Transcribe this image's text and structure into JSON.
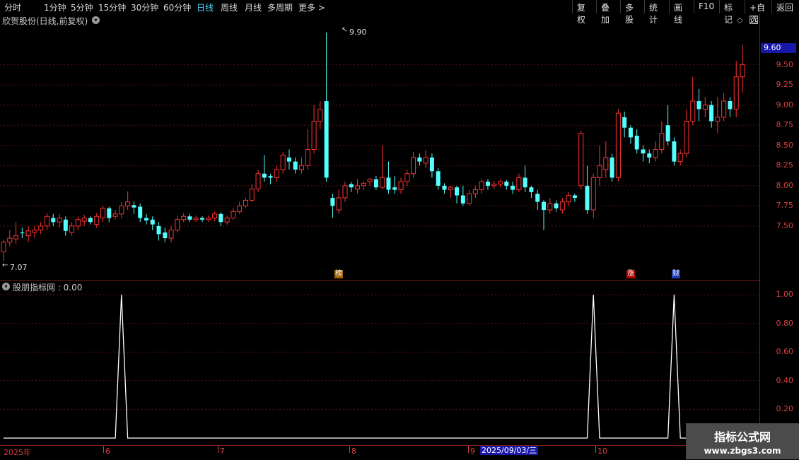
{
  "toolbar": {
    "periods": [
      "分时",
      "1分钟",
      "5分钟",
      "15分钟",
      "30分钟",
      "60分钟",
      "日线",
      "周线",
      "月线",
      "多周期",
      "更多 >"
    ],
    "active_period": "日线",
    "actions": [
      "复权",
      "叠加",
      "多股",
      "统计",
      "画线",
      "F10",
      "标记",
      "+自选",
      "返回"
    ]
  },
  "main": {
    "title": "欣贺股份(日线,前复权)",
    "high_label": "9.90",
    "low_label": "7.07",
    "current_price": "9.60",
    "yticks": [
      "9.50",
      "9.25",
      "9.00",
      "8.75",
      "8.50",
      "8.25",
      "8.00",
      "7.75",
      "7.50"
    ],
    "markers": [
      {
        "text": "榜",
        "color": "#a06000"
      },
      {
        "text": "涨",
        "color": "#b00000"
      },
      {
        "text": "财",
        "color": "#1a3ab0"
      }
    ]
  },
  "indicator": {
    "title": "股朋指标网 : 0.00",
    "yticks": [
      "1.00",
      "0.80",
      "0.60",
      "0.40",
      "0.20"
    ]
  },
  "xaxis": {
    "labels": [
      "2025年",
      "6",
      "7",
      "8",
      "9",
      "10"
    ],
    "selected_date": "2025/09/03/三"
  },
  "watermark": {
    "line1": "指标公式网",
    "line2": "www.zbgs3.com"
  },
  "colors": {
    "up": "#ff3232",
    "down": "#54ffff",
    "signal": "#ffffff",
    "axis": "#d84040"
  },
  "chart_data": {
    "type": "candlestick",
    "ylim": [
      7.07,
      9.9
    ],
    "candles": [
      [
        7.18,
        7.3,
        7.07,
        7.33
      ],
      [
        7.3,
        7.35,
        7.25,
        7.45
      ],
      [
        7.34,
        7.38,
        7.28,
        7.55
      ],
      [
        7.42,
        7.41,
        7.35,
        7.48
      ],
      [
        7.38,
        7.44,
        7.3,
        7.5
      ],
      [
        7.42,
        7.45,
        7.36,
        7.5
      ],
      [
        7.45,
        7.5,
        7.4,
        7.55
      ],
      [
        7.5,
        7.62,
        7.45,
        7.66
      ],
      [
        7.6,
        7.55,
        7.5,
        7.65
      ],
      [
        7.55,
        7.6,
        7.48,
        7.65
      ],
      [
        7.58,
        7.44,
        7.38,
        7.62
      ],
      [
        7.42,
        7.5,
        7.38,
        7.55
      ],
      [
        7.5,
        7.58,
        7.45,
        7.62
      ],
      [
        7.56,
        7.6,
        7.5,
        7.64
      ],
      [
        7.6,
        7.55,
        7.52,
        7.62
      ],
      [
        7.52,
        7.62,
        7.48,
        7.66
      ],
      [
        7.6,
        7.72,
        7.55,
        7.75
      ],
      [
        7.72,
        7.6,
        7.55,
        7.74
      ],
      [
        7.62,
        7.65,
        7.58,
        7.7
      ],
      [
        7.65,
        7.75,
        7.6,
        7.8
      ],
      [
        7.75,
        7.8,
        7.7,
        7.93
      ],
      [
        7.76,
        7.73,
        7.65,
        7.8
      ],
      [
        7.74,
        7.6,
        7.55,
        7.78
      ],
      [
        7.6,
        7.57,
        7.52,
        7.65
      ],
      [
        7.58,
        7.52,
        7.45,
        7.62
      ],
      [
        7.5,
        7.4,
        7.32,
        7.55
      ],
      [
        7.42,
        7.35,
        7.3,
        7.48
      ],
      [
        7.35,
        7.45,
        7.3,
        7.5
      ],
      [
        7.45,
        7.58,
        7.42,
        7.62
      ],
      [
        7.58,
        7.62,
        7.55,
        7.66
      ],
      [
        7.62,
        7.58,
        7.55,
        7.65
      ],
      [
        7.58,
        7.6,
        7.55,
        7.63
      ],
      [
        7.6,
        7.58,
        7.55,
        7.62
      ],
      [
        7.58,
        7.6,
        7.55,
        7.63
      ],
      [
        7.6,
        7.65,
        7.56,
        7.68
      ],
      [
        7.65,
        7.55,
        7.5,
        7.67
      ],
      [
        7.55,
        7.6,
        7.52,
        7.63
      ],
      [
        7.6,
        7.68,
        7.58,
        7.72
      ],
      [
        7.68,
        7.75,
        7.65,
        7.8
      ],
      [
        7.75,
        7.82,
        7.72,
        7.85
      ],
      [
        7.82,
        7.96,
        7.8,
        8.02
      ],
      [
        7.96,
        8.15,
        7.92,
        8.2
      ],
      [
        8.15,
        8.1,
        8.05,
        8.38
      ],
      [
        8.12,
        8.1,
        8.02,
        8.15
      ],
      [
        8.1,
        8.2,
        8.05,
        8.25
      ],
      [
        8.2,
        8.38,
        8.15,
        8.42
      ],
      [
        8.35,
        8.3,
        8.2,
        8.45
      ],
      [
        8.3,
        8.2,
        8.15,
        8.35
      ],
      [
        8.2,
        8.25,
        8.15,
        8.35
      ],
      [
        8.25,
        8.45,
        8.2,
        8.7
      ],
      [
        8.45,
        8.8,
        8.4,
        9.0
      ],
      [
        8.8,
        8.95,
        8.7,
        9.05
      ],
      [
        9.05,
        8.1,
        8.05,
        9.9
      ],
      [
        7.85,
        7.75,
        7.6,
        7.9
      ],
      [
        7.7,
        7.85,
        7.65,
        7.95
      ],
      [
        7.85,
        8.0,
        7.8,
        8.05
      ],
      [
        8.02,
        7.98,
        7.92,
        8.05
      ],
      [
        7.96,
        8.0,
        7.9,
        8.08
      ],
      [
        8.0,
        8.03,
        7.95,
        8.05
      ],
      [
        8.05,
        8.08,
        8.0,
        8.1
      ],
      [
        8.08,
        7.98,
        7.95,
        8.12
      ],
      [
        7.98,
        8.1,
        7.96,
        8.5
      ],
      [
        8.1,
        7.95,
        7.9,
        8.3
      ],
      [
        7.98,
        7.95,
        7.9,
        8.12
      ],
      [
        7.95,
        8.05,
        7.9,
        8.1
      ],
      [
        8.05,
        8.15,
        8.0,
        8.2
      ],
      [
        8.15,
        8.35,
        8.1,
        8.42
      ],
      [
        8.35,
        8.3,
        8.25,
        8.4
      ],
      [
        8.28,
        8.35,
        8.22,
        8.44
      ],
      [
        8.35,
        8.18,
        8.1,
        8.4
      ],
      [
        8.18,
        8.0,
        7.95,
        8.22
      ],
      [
        8.0,
        7.95,
        7.9,
        8.03
      ],
      [
        7.95,
        7.98,
        7.85,
        8.0
      ],
      [
        7.98,
        7.88,
        7.78,
        8.0
      ],
      [
        7.88,
        7.78,
        7.75,
        8.0
      ],
      [
        7.78,
        7.9,
        7.75,
        7.95
      ],
      [
        7.9,
        7.95,
        7.85,
        8.0
      ],
      [
        7.95,
        8.05,
        7.9,
        8.08
      ],
      [
        8.05,
        8.0,
        7.95,
        8.08
      ],
      [
        8.0,
        8.02,
        7.96,
        8.06
      ],
      [
        8.02,
        8.05,
        7.98,
        8.08
      ],
      [
        8.05,
        8.0,
        7.95,
        8.07
      ],
      [
        8.0,
        7.95,
        7.9,
        8.05
      ],
      [
        7.95,
        8.1,
        7.92,
        8.15
      ],
      [
        8.1,
        7.98,
        7.92,
        8.25
      ],
      [
        7.98,
        7.92,
        7.85,
        8.0
      ],
      [
        7.9,
        7.8,
        7.7,
        7.95
      ],
      [
        7.8,
        7.7,
        7.45,
        7.82
      ],
      [
        7.7,
        7.78,
        7.65,
        7.85
      ],
      [
        7.78,
        7.72,
        7.68,
        7.82
      ],
      [
        7.7,
        7.8,
        7.65,
        7.85
      ],
      [
        7.8,
        7.88,
        7.75,
        7.92
      ],
      [
        7.88,
        7.85,
        7.8,
        7.9
      ],
      [
        8.0,
        8.65,
        7.95,
        8.68
      ],
      [
        8.0,
        7.7,
        7.65,
        8.25
      ],
      [
        7.7,
        8.1,
        7.6,
        8.15
      ],
      [
        8.1,
        8.25,
        8.0,
        8.5
      ],
      [
        8.2,
        8.35,
        8.1,
        8.55
      ],
      [
        8.35,
        8.1,
        8.05,
        8.4
      ],
      [
        8.1,
        8.9,
        8.05,
        8.95
      ],
      [
        8.85,
        8.72,
        8.6,
        8.92
      ],
      [
        8.72,
        8.6,
        8.52,
        8.75
      ],
      [
        8.62,
        8.45,
        8.4,
        8.7
      ],
      [
        8.45,
        8.4,
        8.3,
        8.5
      ],
      [
        8.4,
        8.35,
        8.28,
        8.45
      ],
      [
        8.35,
        8.45,
        8.3,
        8.55
      ],
      [
        8.45,
        8.65,
        8.4,
        8.8
      ],
      [
        8.75,
        8.55,
        8.5,
        9.0
      ],
      [
        8.55,
        8.3,
        8.25,
        8.6
      ],
      [
        8.3,
        8.4,
        8.25,
        8.45
      ],
      [
        8.4,
        8.8,
        8.35,
        8.95
      ],
      [
        8.8,
        9.05,
        8.75,
        9.35
      ],
      [
        9.05,
        8.95,
        8.8,
        9.2
      ],
      [
        8.95,
        9.0,
        8.85,
        9.1
      ],
      [
        9.0,
        8.8,
        8.72,
        9.05
      ],
      [
        8.8,
        8.85,
        8.65,
        9.1
      ],
      [
        8.85,
        9.05,
        8.8,
        9.15
      ],
      [
        9.05,
        8.95,
        8.85,
        9.1
      ],
      [
        8.95,
        9.35,
        8.85,
        9.55
      ],
      [
        9.35,
        9.5,
        9.15,
        9.75
      ]
    ]
  },
  "signal_data": {
    "type": "line",
    "total_bars": 120,
    "peak_bars": [
      19,
      95,
      108
    ],
    "ylim": [
      0,
      1.05
    ]
  }
}
